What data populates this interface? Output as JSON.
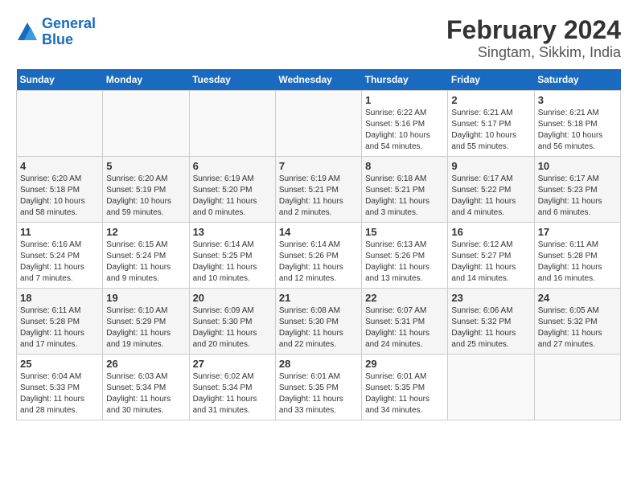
{
  "header": {
    "logo_general": "General",
    "logo_blue": "Blue",
    "title": "February 2024",
    "subtitle": "Singtam, Sikkim, India"
  },
  "weekdays": [
    "Sunday",
    "Monday",
    "Tuesday",
    "Wednesday",
    "Thursday",
    "Friday",
    "Saturday"
  ],
  "weeks": [
    [
      {
        "num": "",
        "info": ""
      },
      {
        "num": "",
        "info": ""
      },
      {
        "num": "",
        "info": ""
      },
      {
        "num": "",
        "info": ""
      },
      {
        "num": "1",
        "info": "Sunrise: 6:22 AM\nSunset: 5:16 PM\nDaylight: 10 hours\nand 54 minutes."
      },
      {
        "num": "2",
        "info": "Sunrise: 6:21 AM\nSunset: 5:17 PM\nDaylight: 10 hours\nand 55 minutes."
      },
      {
        "num": "3",
        "info": "Sunrise: 6:21 AM\nSunset: 5:18 PM\nDaylight: 10 hours\nand 56 minutes."
      }
    ],
    [
      {
        "num": "4",
        "info": "Sunrise: 6:20 AM\nSunset: 5:18 PM\nDaylight: 10 hours\nand 58 minutes."
      },
      {
        "num": "5",
        "info": "Sunrise: 6:20 AM\nSunset: 5:19 PM\nDaylight: 10 hours\nand 59 minutes."
      },
      {
        "num": "6",
        "info": "Sunrise: 6:19 AM\nSunset: 5:20 PM\nDaylight: 11 hours\nand 0 minutes."
      },
      {
        "num": "7",
        "info": "Sunrise: 6:19 AM\nSunset: 5:21 PM\nDaylight: 11 hours\nand 2 minutes."
      },
      {
        "num": "8",
        "info": "Sunrise: 6:18 AM\nSunset: 5:21 PM\nDaylight: 11 hours\nand 3 minutes."
      },
      {
        "num": "9",
        "info": "Sunrise: 6:17 AM\nSunset: 5:22 PM\nDaylight: 11 hours\nand 4 minutes."
      },
      {
        "num": "10",
        "info": "Sunrise: 6:17 AM\nSunset: 5:23 PM\nDaylight: 11 hours\nand 6 minutes."
      }
    ],
    [
      {
        "num": "11",
        "info": "Sunrise: 6:16 AM\nSunset: 5:24 PM\nDaylight: 11 hours\nand 7 minutes."
      },
      {
        "num": "12",
        "info": "Sunrise: 6:15 AM\nSunset: 5:24 PM\nDaylight: 11 hours\nand 9 minutes."
      },
      {
        "num": "13",
        "info": "Sunrise: 6:14 AM\nSunset: 5:25 PM\nDaylight: 11 hours\nand 10 minutes."
      },
      {
        "num": "14",
        "info": "Sunrise: 6:14 AM\nSunset: 5:26 PM\nDaylight: 11 hours\nand 12 minutes."
      },
      {
        "num": "15",
        "info": "Sunrise: 6:13 AM\nSunset: 5:26 PM\nDaylight: 11 hours\nand 13 minutes."
      },
      {
        "num": "16",
        "info": "Sunrise: 6:12 AM\nSunset: 5:27 PM\nDaylight: 11 hours\nand 14 minutes."
      },
      {
        "num": "17",
        "info": "Sunrise: 6:11 AM\nSunset: 5:28 PM\nDaylight: 11 hours\nand 16 minutes."
      }
    ],
    [
      {
        "num": "18",
        "info": "Sunrise: 6:11 AM\nSunset: 5:28 PM\nDaylight: 11 hours\nand 17 minutes."
      },
      {
        "num": "19",
        "info": "Sunrise: 6:10 AM\nSunset: 5:29 PM\nDaylight: 11 hours\nand 19 minutes."
      },
      {
        "num": "20",
        "info": "Sunrise: 6:09 AM\nSunset: 5:30 PM\nDaylight: 11 hours\nand 20 minutes."
      },
      {
        "num": "21",
        "info": "Sunrise: 6:08 AM\nSunset: 5:30 PM\nDaylight: 11 hours\nand 22 minutes."
      },
      {
        "num": "22",
        "info": "Sunrise: 6:07 AM\nSunset: 5:31 PM\nDaylight: 11 hours\nand 24 minutes."
      },
      {
        "num": "23",
        "info": "Sunrise: 6:06 AM\nSunset: 5:32 PM\nDaylight: 11 hours\nand 25 minutes."
      },
      {
        "num": "24",
        "info": "Sunrise: 6:05 AM\nSunset: 5:32 PM\nDaylight: 11 hours\nand 27 minutes."
      }
    ],
    [
      {
        "num": "25",
        "info": "Sunrise: 6:04 AM\nSunset: 5:33 PM\nDaylight: 11 hours\nand 28 minutes."
      },
      {
        "num": "26",
        "info": "Sunrise: 6:03 AM\nSunset: 5:34 PM\nDaylight: 11 hours\nand 30 minutes."
      },
      {
        "num": "27",
        "info": "Sunrise: 6:02 AM\nSunset: 5:34 PM\nDaylight: 11 hours\nand 31 minutes."
      },
      {
        "num": "28",
        "info": "Sunrise: 6:01 AM\nSunset: 5:35 PM\nDaylight: 11 hours\nand 33 minutes."
      },
      {
        "num": "29",
        "info": "Sunrise: 6:01 AM\nSunset: 5:35 PM\nDaylight: 11 hours\nand 34 minutes."
      },
      {
        "num": "",
        "info": ""
      },
      {
        "num": "",
        "info": ""
      }
    ]
  ]
}
